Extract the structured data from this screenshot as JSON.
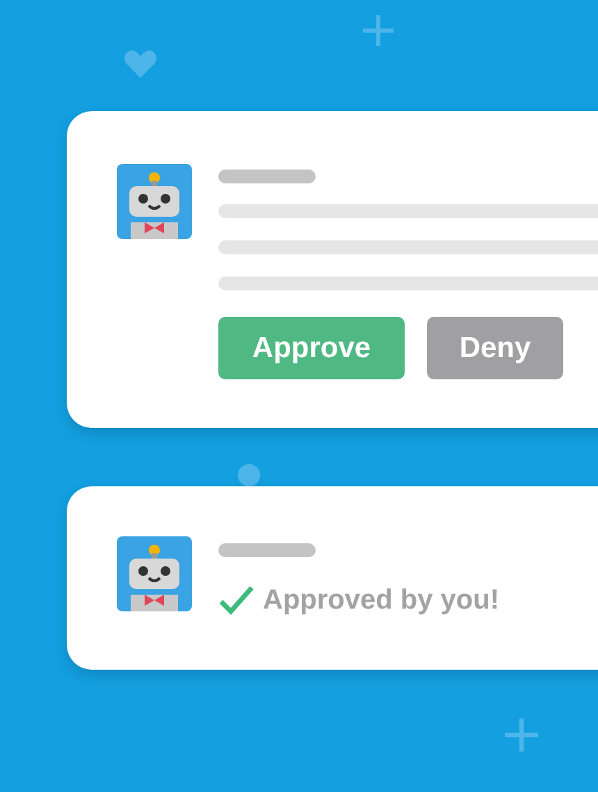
{
  "cards": [
    {
      "kind": "request",
      "buttons": [
        {
          "label": "Approve",
          "kind": "approve"
        },
        {
          "label": "Deny",
          "kind": "deny"
        }
      ]
    },
    {
      "kind": "approved",
      "status": "Approved by you!"
    }
  ]
}
